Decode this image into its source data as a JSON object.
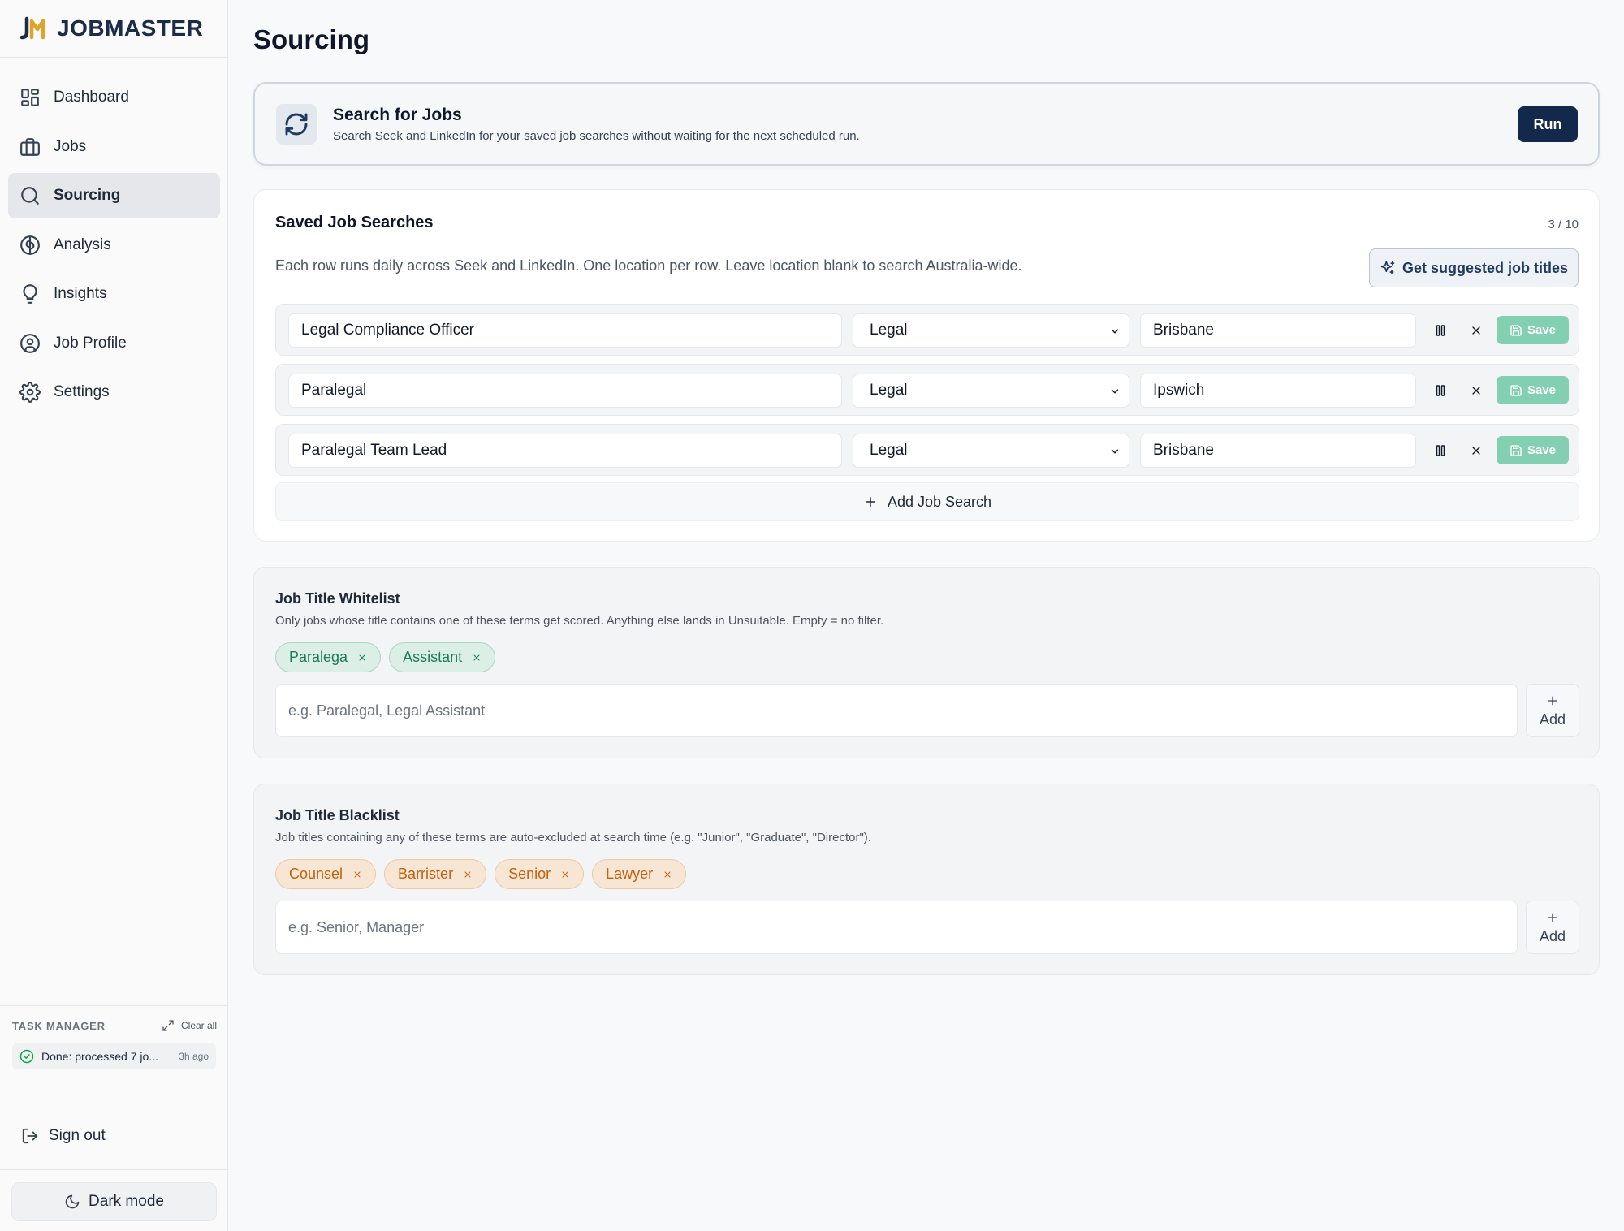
{
  "app": {
    "brand": "JOBMASTER"
  },
  "sidebar": {
    "items": [
      {
        "label": "Dashboard",
        "icon": "dashboard-icon"
      },
      {
        "label": "Jobs",
        "icon": "briefcase-icon"
      },
      {
        "label": "Sourcing",
        "icon": "search-icon",
        "active": true
      },
      {
        "label": "Analysis",
        "icon": "brain-icon"
      },
      {
        "label": "Insights",
        "icon": "lightbulb-icon"
      },
      {
        "label": "Job Profile",
        "icon": "user-circle-icon"
      },
      {
        "label": "Settings",
        "icon": "gear-icon"
      }
    ],
    "task_manager": {
      "title": "TASK MANAGER",
      "clear_label": "Clear all",
      "task_text": "Done: processed 7 jo...",
      "task_time": "3h ago"
    },
    "sign_out": "Sign out",
    "dark_mode": "Dark mode"
  },
  "page": {
    "title": "Sourcing"
  },
  "run_card": {
    "title": "Search for Jobs",
    "description": "Search Seek and LinkedIn for your saved job searches without waiting for the next scheduled run.",
    "button": "Run"
  },
  "saved_searches": {
    "title": "Saved Job Searches",
    "count": "3 / 10",
    "description": "Each row runs daily across Seek and LinkedIn. One location per row. Leave location blank to search Australia-wide.",
    "suggest_button": "Get suggested job titles",
    "save_label": "Save",
    "rows": [
      {
        "title": "Legal Compliance Officer",
        "category": "Legal",
        "location": "Brisbane"
      },
      {
        "title": "Paralegal",
        "category": "Legal",
        "location": "Ipswich"
      },
      {
        "title": "Paralegal Team Lead",
        "category": "Legal",
        "location": "Brisbane"
      }
    ],
    "add_button": "Add Job Search"
  },
  "whitelist": {
    "title": "Job Title Whitelist",
    "description": "Only jobs whose title contains one of these terms get scored. Anything else lands in Unsuitable. Empty = no filter.",
    "terms": [
      "Paralega",
      "Assistant"
    ],
    "placeholder": "e.g. Paralegal, Legal Assistant",
    "add_label": "Add"
  },
  "blacklist": {
    "title": "Job Title Blacklist",
    "description": "Job titles containing any of these terms are auto-excluded at search time (e.g. \"Junior\", \"Graduate\", \"Director\").",
    "terms": [
      "Counsel",
      "Barrister",
      "Senior",
      "Lawyer"
    ],
    "placeholder": "e.g. Senior, Manager",
    "add_label": "Add"
  },
  "colors": {
    "primary": "#13294b",
    "save_green": "#82cfb1",
    "whitelist_chip": "#dbefe7",
    "blacklist_chip": "#f8e6d5"
  }
}
